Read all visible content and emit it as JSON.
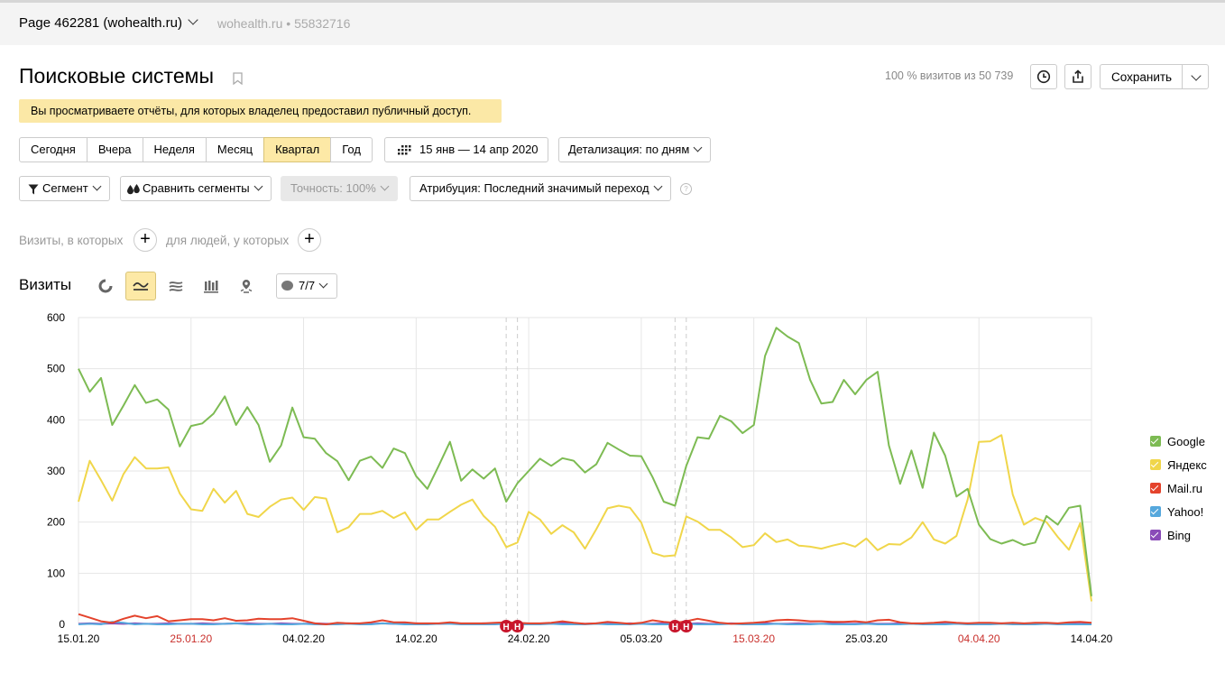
{
  "topbar": {
    "counter_name": "Page 462281 (wohealth.ru)",
    "site": "wohealth.ru",
    "separator": "•",
    "counter_id": "55832716"
  },
  "header": {
    "title": "Поисковые системы",
    "stat": "100 % визитов из 50 739",
    "save_label": "Сохранить"
  },
  "notice": "Вы просматриваете отчёты, для которых владелец предоставил публичный доступ.",
  "periods": [
    {
      "label": "Сегодня",
      "active": false
    },
    {
      "label": "Вчера",
      "active": false
    },
    {
      "label": "Неделя",
      "active": false
    },
    {
      "label": "Месяц",
      "active": false
    },
    {
      "label": "Квартал",
      "active": true
    },
    {
      "label": "Год",
      "active": false
    }
  ],
  "date_range": "15 янв — 14 апр 2020",
  "detail": "Детализация: по дням",
  "filters": {
    "segment": "Сегмент",
    "compare": "Сравнить сегменты",
    "accuracy": "Точность: 100%",
    "attribution": "Атрибуция: Последний значимый переход",
    "help": "?"
  },
  "conditions": {
    "visits_label": "Визиты, в которых",
    "people_label": "для людей, у которых",
    "plus": "+"
  },
  "view": {
    "title": "Визиты",
    "comments_label": "7/7",
    "icons": [
      "pie-chart-icon",
      "line-chart-icon",
      "stacked-area-icon",
      "bar-chart-icon",
      "map-icon"
    ],
    "active_icon": "line-chart-icon"
  },
  "chart_data": {
    "type": "line",
    "x_ticks": [
      "15.01.20",
      "25.01.20",
      "04.02.20",
      "14.02.20",
      "24.02.20",
      "05.03.20",
      "15.03.20",
      "25.03.20",
      "04.04.20",
      "14.04.20"
    ],
    "x_ticks_holiday": [
      false,
      true,
      false,
      false,
      false,
      false,
      true,
      false,
      true,
      false
    ],
    "y_ticks": [
      0,
      100,
      200,
      300,
      400,
      500,
      600
    ],
    "ylim": [
      0,
      600
    ],
    "x_start": "2020-01-15",
    "x_end": "2020-04-14",
    "holiday_markers": [
      "2020-02-22",
      "2020-02-23",
      "2020-03-08",
      "2020-03-09"
    ],
    "holiday_marker_label": "Н",
    "series": [
      {
        "name": "Google",
        "color": "#7dbb53",
        "values": [
          500,
          455,
          482,
          390,
          428,
          468,
          433,
          440,
          420,
          348,
          388,
          393,
          412,
          446,
          390,
          425,
          390,
          318,
          350,
          424,
          366,
          363,
          335,
          319,
          282,
          320,
          328,
          306,
          344,
          335,
          290,
          265,
          310,
          357,
          281,
          303,
          285,
          305,
          240,
          276,
          300,
          324,
          310,
          325,
          320,
          297,
          313,
          355,
          342,
          330,
          329,
          288,
          240,
          232,
          310,
          366,
          363,
          408,
          397,
          374,
          390,
          525,
          580,
          563,
          550,
          478,
          432,
          435,
          478,
          450,
          478,
          494,
          350,
          275,
          340,
          267,
          375,
          330,
          250,
          265,
          195,
          167,
          158,
          165,
          155,
          160,
          212,
          195,
          228,
          232,
          55
        ]
      },
      {
        "name": "Яндекс",
        "color": "#f0d64a",
        "values": [
          240,
          320,
          282,
          242,
          294,
          327,
          305,
          305,
          307,
          256,
          225,
          222,
          265,
          238,
          261,
          216,
          210,
          230,
          244,
          248,
          224,
          249,
          246,
          180,
          190,
          216,
          216,
          222,
          208,
          219,
          185,
          205,
          205,
          220,
          234,
          244,
          212,
          191,
          151,
          160,
          220,
          205,
          177,
          194,
          180,
          148,
          186,
          227,
          232,
          228,
          199,
          140,
          133,
          135,
          211,
          201,
          185,
          185,
          170,
          151,
          155,
          178,
          161,
          166,
          154,
          152,
          148,
          154,
          159,
          152,
          168,
          145,
          157,
          156,
          170,
          200,
          166,
          158,
          173,
          244,
          357,
          358,
          370,
          254,
          195,
          208,
          200,
          171,
          146,
          198,
          45
        ]
      },
      {
        "name": "Mail.ru",
        "color": "#e4432c",
        "values": [
          20,
          13,
          6,
          3,
          11,
          17,
          12,
          16,
          6,
          8,
          10,
          10,
          8,
          12,
          7,
          8,
          11,
          10,
          10,
          12,
          7,
          2,
          0,
          3,
          2,
          2,
          4,
          8,
          4,
          4,
          2,
          2,
          2,
          4,
          2,
          2,
          2,
          3,
          4,
          3,
          2,
          2,
          3,
          6,
          3,
          1,
          2,
          5,
          3,
          1,
          3,
          8,
          5,
          3,
          6,
          11,
          7,
          3,
          1,
          2,
          3,
          5,
          8,
          9,
          8,
          6,
          6,
          5,
          5,
          6,
          4,
          8,
          9,
          4,
          2,
          2,
          3,
          5,
          3,
          2,
          3,
          3,
          2,
          3,
          2,
          3,
          3,
          2,
          4,
          5,
          3
        ]
      },
      {
        "name": "Yahoo!",
        "color": "#56a8dd",
        "values": [
          0,
          1,
          0,
          5,
          3,
          0,
          1,
          0,
          0,
          1,
          1,
          0,
          0,
          1,
          2,
          0,
          0,
          1,
          0,
          0,
          1,
          0,
          0,
          0,
          1,
          0,
          0,
          2,
          1,
          0,
          0,
          0,
          1,
          1,
          0,
          0,
          0,
          0,
          1,
          0,
          0,
          0,
          1,
          0,
          0,
          0,
          1,
          0,
          0,
          0,
          1,
          0,
          0,
          0,
          1,
          0,
          0,
          0,
          1,
          0,
          0,
          0,
          1,
          0,
          0,
          0,
          1,
          0,
          0,
          0,
          1,
          0,
          0,
          0,
          1,
          0,
          0,
          0,
          1,
          0,
          0,
          0,
          1,
          0,
          0,
          0,
          1,
          0,
          0,
          0,
          0
        ]
      },
      {
        "name": "Bing",
        "color": "#8a4bb8",
        "values": [
          1,
          2,
          1,
          2,
          1,
          2,
          1,
          1,
          2,
          1,
          1,
          2,
          1,
          1,
          2,
          2,
          1,
          1,
          2,
          1,
          1,
          2,
          1,
          1,
          2,
          1,
          1,
          2,
          1,
          1,
          2,
          1,
          1,
          2,
          1,
          1,
          2,
          1,
          1,
          2,
          1,
          1,
          2,
          3,
          2,
          1,
          2,
          1,
          1,
          2,
          1,
          1,
          2,
          1,
          1,
          2,
          1,
          1,
          2,
          1,
          1,
          2,
          1,
          1,
          2,
          1,
          1,
          2,
          1,
          1,
          2,
          1,
          1,
          2,
          1,
          1,
          2,
          1,
          1,
          2,
          1,
          1,
          2,
          1,
          1,
          2,
          1,
          1,
          2,
          1,
          1
        ]
      }
    ],
    "legend": "right",
    "grid": true
  }
}
